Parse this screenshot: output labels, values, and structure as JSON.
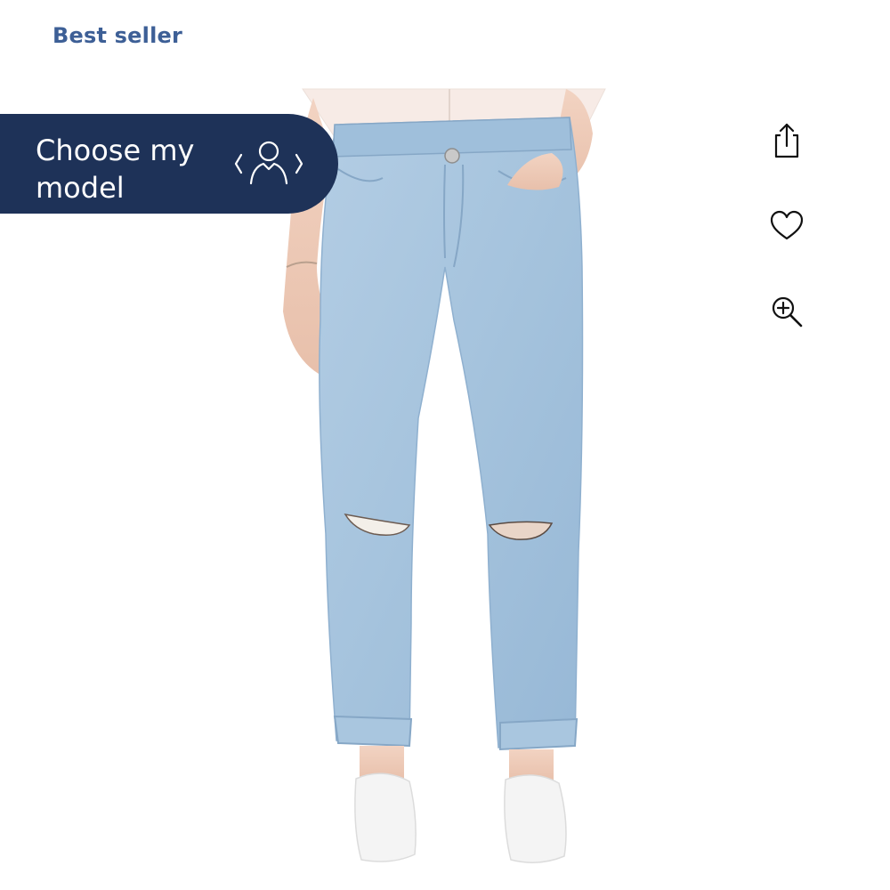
{
  "badge": {
    "label": "Best seller"
  },
  "product_image": {
    "subject": "light wash distressed mom jeans with rolled cuffs, white sneakers, white top",
    "denim_color": "#a9c6df"
  },
  "choose_model": {
    "label": "Choose my model",
    "background": "#1e3258",
    "icon": "person-switch-icon"
  },
  "actions": {
    "share_icon": "share-icon",
    "favorite_icon": "heart-icon",
    "zoom_icon": "zoom-in-icon"
  },
  "colors": {
    "badge_text": "#3d5f96",
    "icon_stroke": "#111111",
    "background": "#ffffff"
  }
}
